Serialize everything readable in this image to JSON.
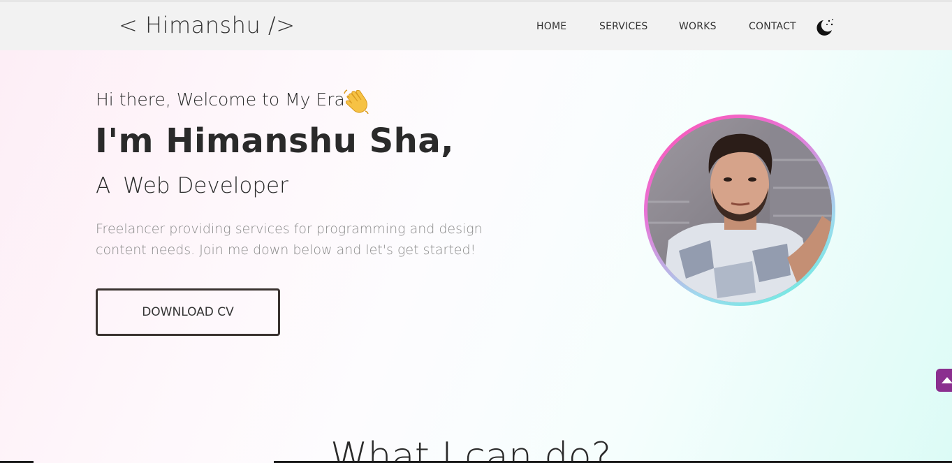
{
  "header": {
    "logo": "< Himanshu />",
    "nav": [
      "HOME",
      "SERVICES",
      "WORKS",
      "CONTACT"
    ],
    "theme_toggle_icon": "moon-stars-icon"
  },
  "hero": {
    "greeting": "Hi there, Welcome to My Era",
    "wave_icon": "waving-hand-icon",
    "name": "I'm Himanshu Sha,",
    "role_prefix": "A",
    "role": "Web Developer",
    "description": "Freelancer providing services for programming and design content needs. Join me down below and let's get started!",
    "cta_label": "DOWNLOAD CV",
    "profile_photo": "profile-photo"
  },
  "services": {
    "heading": "What I can do?"
  },
  "scroll_top_icon": "arrow-up-icon",
  "colors": {
    "nav_bg": "#f2f2f2",
    "text": "#2a2a2a",
    "muted": "#8a8a8a",
    "ring_start": "#ff4fb0",
    "ring_end": "#5ef1dc",
    "scroll_button": "#8b2f8f"
  }
}
